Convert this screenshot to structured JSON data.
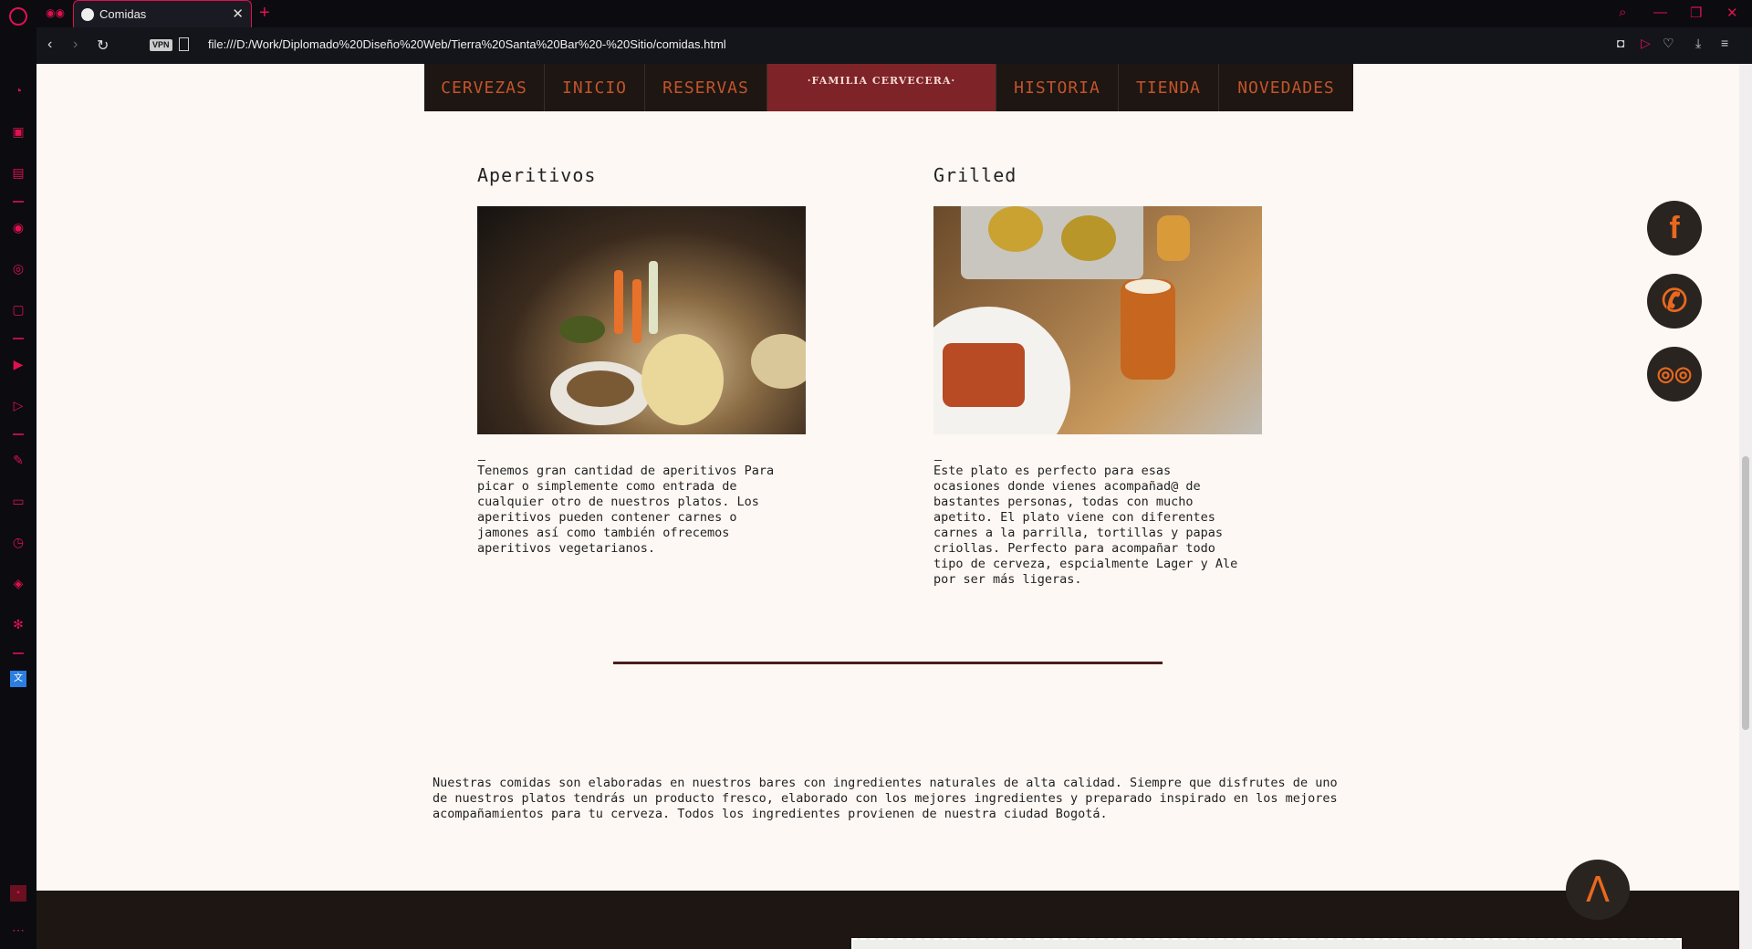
{
  "browser": {
    "tab_title": "Comidas",
    "url": "file:///D:/Work/Diplomado%20Diseño%20Web/Tierra%20Santa%20Bar%20-%20Sitio/comidas.html",
    "vpn_label": "VPN",
    "accent": "#e0114f"
  },
  "nav": {
    "items": [
      "CERVEZAS",
      "INICIO",
      "RESERVAS"
    ],
    "brand": "·FAMILIA CERVECERA·",
    "items_right": [
      "HISTORIA",
      "TIENDA",
      "NOVEDADES"
    ]
  },
  "cards": [
    {
      "title": "Aperitivos",
      "photo_icon": "appetizers-photo",
      "description": "Tenemos gran cantidad de aperitivos Para\npicar o simplemente como entrada de\ncualquier otro de nuestros platos. Los\naperitivos pueden contener carnes o\njamones así como también ofrecemos\naperitivos vegetarianos."
    },
    {
      "title": "Grilled",
      "photo_icon": "grilled-food-photo",
      "description": "Este plato es perfecto para esas\nocasiones donde vienes acompañad@ de\nbastantes personas, todas con mucho\napetito. El plato viene con diferentes\ncarnes a la parrilla, tortillas y papas\ncriollas. Perfecto para acompañar todo\ntipo de cerveza, espcialmente Lager y Ale\npor ser más ligeras."
    }
  ],
  "footer_text": "Nuestras comidas son elaboradas en nuestros bares con ingredientes naturales de alta calidad. Siempre que disfrutes de uno de nuestros platos tendrás un producto fresco, elaborado con los mejores ingredientes y preparado inspirado en los mejores acompañamientos para tu cerveza. Todos los ingredientes provienen de nuestra ciudad Bogotá.",
  "social": [
    "facebook-icon",
    "phone-icon",
    "tripadvisor-icon"
  ],
  "back_to_top": "Λ",
  "colors": {
    "page_bg": "#fdf8f4",
    "nav_bg": "#1d1612",
    "nav_text": "#c3542a",
    "brand_bg": "#7e2328",
    "social_icon": "#e8691e"
  }
}
